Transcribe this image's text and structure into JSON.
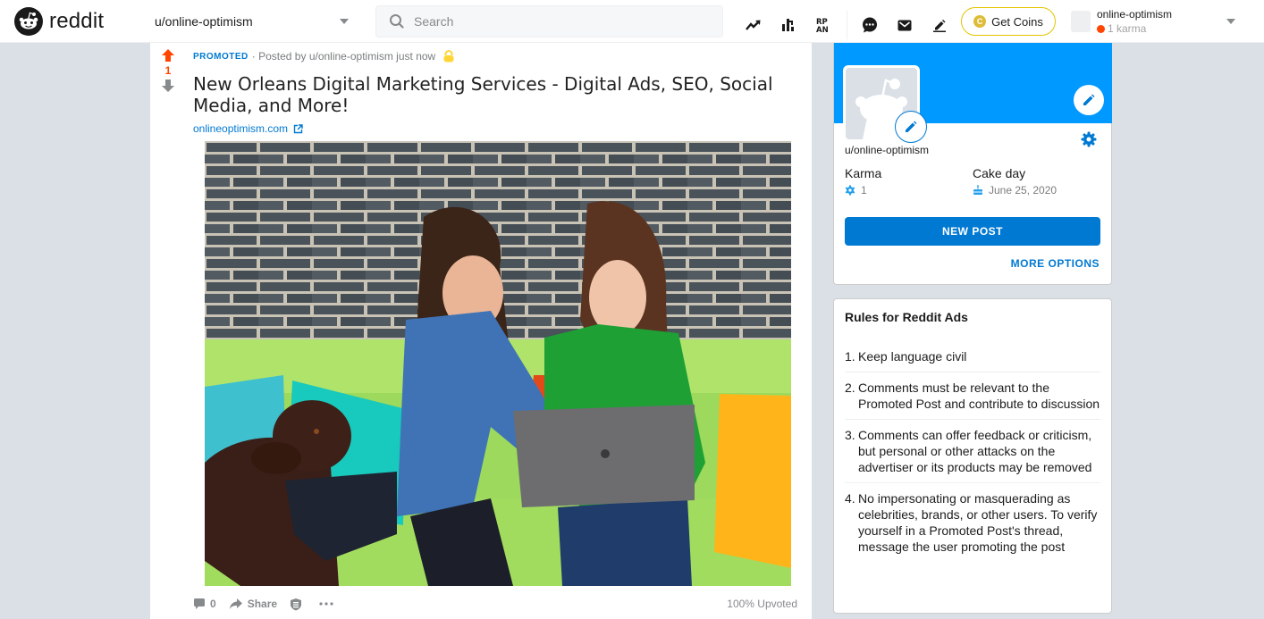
{
  "header": {
    "brand": "reddit",
    "community": "u/online-optimism",
    "search_placeholder": "Search",
    "icons": [
      "trending-icon",
      "stats-icon",
      "rpan-icon",
      "chat-icon",
      "mail-icon",
      "create-post-icon"
    ],
    "coins_label": "Get Coins",
    "coin_glyph": "C",
    "user": {
      "name": "online-optimism",
      "karma": "1 karma"
    }
  },
  "post": {
    "votes": "1",
    "promoted_label": "PROMOTED",
    "posted_by": "· Posted by u/online-optimism just now",
    "title": "New Orleans Digital Marketing Services - Digital Ads, SEO, Social Media, and More!",
    "link": "onlineoptimism.com",
    "image_alt": "Two women on a green couch with a laptop and a brown dog",
    "footer": {
      "comments": "0",
      "share": "Share",
      "upvoted": "100% Upvoted"
    }
  },
  "profile": {
    "username": "u/online-optimism",
    "karma_label": "Karma",
    "karma_value": "1",
    "cakeday_label": "Cake day",
    "cakeday_value": "June 25, 2020",
    "new_post": "NEW POST",
    "more_options": "MORE OPTIONS"
  },
  "rules": {
    "title": "Rules for Reddit Ads",
    "items": [
      {
        "num": "1.",
        "text": "Keep language civil"
      },
      {
        "num": "2.",
        "text": "Comments must be relevant to the Promoted Post and contribute to discussion"
      },
      {
        "num": "3.",
        "text": "Comments can offer feedback or criticism, but personal or other attacks on the advertiser or its products may be removed"
      },
      {
        "num": "4.",
        "text": "No impersonating or masquerading as celebrities, brands, or other users. To verify yourself in a Promoted Post's thread, message the user promoting the post"
      }
    ]
  },
  "colors": {
    "accent": "#0079d3",
    "upvote": "#ff4500",
    "banner": "#0099ff",
    "coin": "#ddbd37"
  }
}
